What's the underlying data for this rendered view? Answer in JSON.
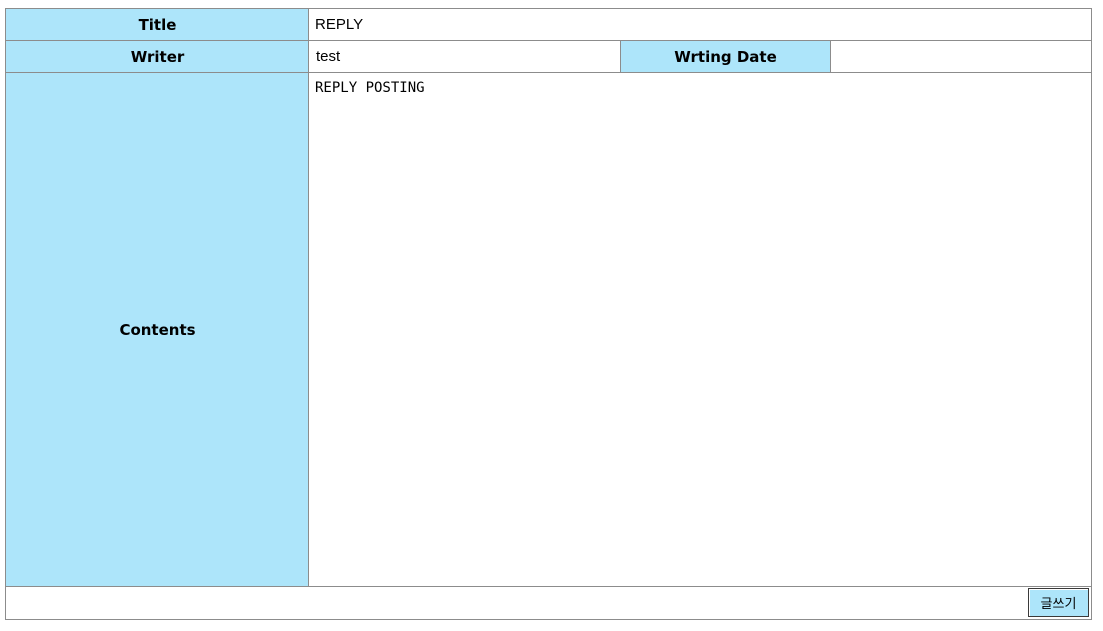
{
  "form": {
    "title_label": "Title",
    "title_value": "REPLY",
    "writer_label": "Writer",
    "writer_value": "test",
    "date_label": "Wrting Date",
    "date_value": "",
    "contents_label": "Contents",
    "contents_value": "REPLY POSTING",
    "submit_label": "글쓰기"
  },
  "colors": {
    "label_background": "#ade5fa",
    "border": "#8c8c8c"
  }
}
